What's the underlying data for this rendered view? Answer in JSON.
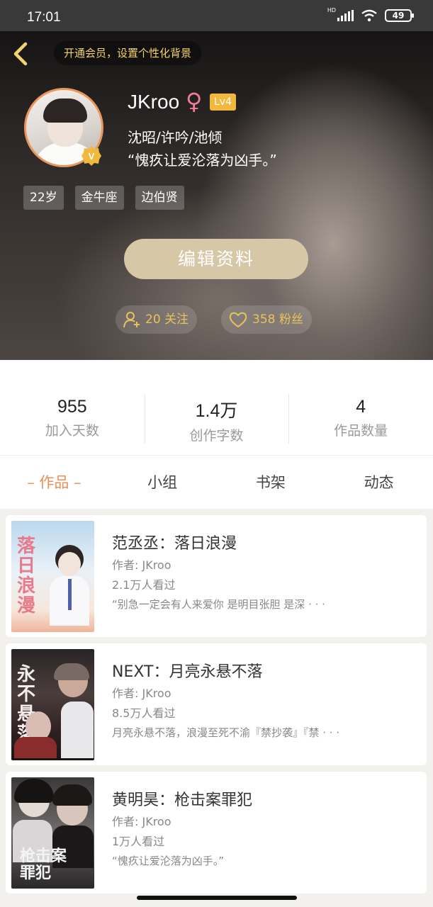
{
  "status_bar": {
    "time": "17:01",
    "network": "HD",
    "battery": "49"
  },
  "header": {
    "vip_banner": "开通会员，设置个性化背景",
    "username": "JKroo",
    "gender_symbol": "♀",
    "level": "Lv4",
    "signature_line1": "沈昭/许吟/池倾",
    "signature_line2": "“愧疚让爱沦落为凶手。”",
    "tags": [
      "22岁",
      "金牛座",
      "边伯贤"
    ],
    "edit_button": "编辑资料",
    "following": "20 关注",
    "followers": "358 粉丝",
    "colors": {
      "vip_text": "#f3d36b",
      "avatar_ring": "#e9965a",
      "gender": "#ef7d96",
      "level_badge": "#f0b83c",
      "edit_button": "#d6c7a7",
      "follow_text": "#e8c25a"
    }
  },
  "stats": [
    {
      "value": "955",
      "label": "加入天数"
    },
    {
      "value": "1.4万",
      "label": "创作字数"
    },
    {
      "value": "4",
      "label": "作品数量"
    }
  ],
  "tabs": [
    {
      "label": "– 作品 –",
      "active": true
    },
    {
      "label": "小组",
      "active": false
    },
    {
      "label": "书架",
      "active": false
    },
    {
      "label": "动态",
      "active": false
    }
  ],
  "accent_color": "#ec8f55",
  "works": [
    {
      "title": "范丞丞：落日浪漫",
      "author": "作者: JKroo",
      "views": "2.1万人看过",
      "desc": "“别急一定会有人来爱你 是明目张胆 是深 · · ·",
      "cover_text": "落日浪漫"
    },
    {
      "title": "NEXT：月亮永悬不落",
      "author": "作者: JKroo",
      "views": "8.5万人看过",
      "desc": "月亮永悬不落，浪漫至死不渝『禁抄袭』『禁 · · ·",
      "cover_text": "永不悬落"
    },
    {
      "title": "黄明昊：枪击案罪犯",
      "author": "作者: JKroo",
      "views": "1万人看过",
      "desc": "“愧疚让爱沦落为凶手。”",
      "cover_text": "枪击案罪犯"
    }
  ]
}
